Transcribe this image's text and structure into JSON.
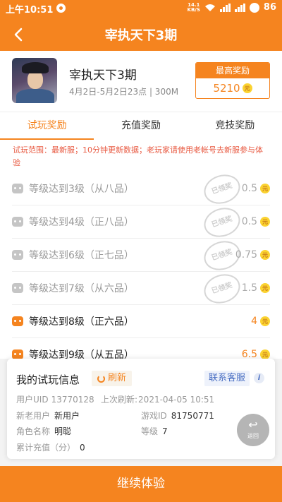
{
  "status": {
    "time": "上午10:51",
    "speed_top": "14.1",
    "speed_bottom": "KB/S",
    "battery": "86"
  },
  "nav": {
    "title": "宰执天下3期"
  },
  "game": {
    "name": "宰执天下3期",
    "meta": "4月2日-5月2日23点 | 300M"
  },
  "prize": {
    "label": "最高奖励",
    "value": "5210",
    "coin": "元"
  },
  "tabs": [
    "试玩奖励",
    "充值奖励",
    "竞技奖励"
  ],
  "notice": "试玩范围：最新服；10分钟更新数据；老玩家请使用老帐号去新服参与体验",
  "stamp_text": "已领奖",
  "tasks": [
    {
      "text": "等级达到3级（从八品）",
      "reward": "0.5",
      "claimed": true
    },
    {
      "text": "等级达到4级（正八品）",
      "reward": "0.5",
      "claimed": true
    },
    {
      "text": "等级达到6级（正七品）",
      "reward": "0.75",
      "claimed": true
    },
    {
      "text": "等级达到7级（从六品）",
      "reward": "1.5",
      "claimed": true
    },
    {
      "text": "等级达到8级（正六品）",
      "reward": "4",
      "claimed": false
    },
    {
      "text": "等级达到9级（从五品）",
      "reward": "6.5",
      "claimed": false
    }
  ],
  "info": {
    "title": "我的试玩信息",
    "refresh": "刷新",
    "service": "联系客服",
    "info_icon": "i",
    "uid_label": "用户UID",
    "uid": "13770128",
    "last_refresh_label": "上次刷新:",
    "last_refresh": "2021-04-05 10:51",
    "user_type_label": "新老用户",
    "user_type": "新用户",
    "game_id_label": "游戏ID",
    "game_id": "81750771",
    "role_label": "角色名称",
    "role": "明聪",
    "level_label": "等级",
    "level": "7",
    "recharge_label": "累计充值（分）",
    "recharge": "0"
  },
  "fab": {
    "label": "返回"
  },
  "cta": {
    "label": "继续体验"
  },
  "colors": {
    "accent": "#f5841f",
    "notice": "#e85a42",
    "link": "#4a6fc3"
  }
}
